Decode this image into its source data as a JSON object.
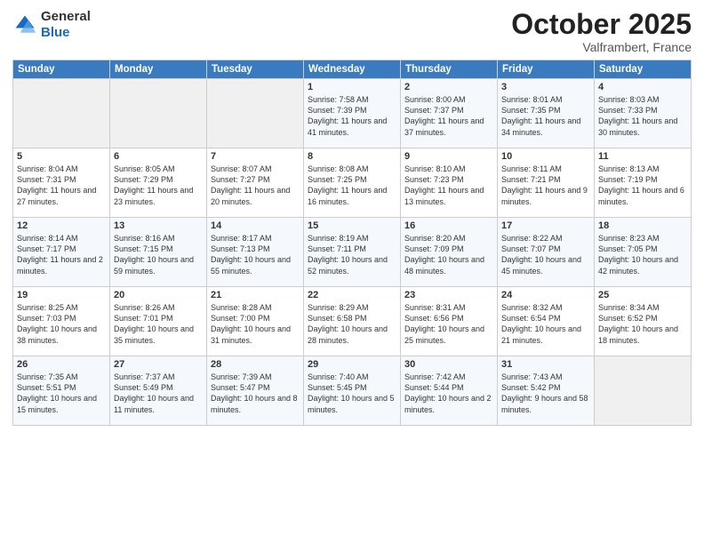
{
  "header": {
    "logo_general": "General",
    "logo_blue": "Blue",
    "month": "October 2025",
    "location": "Valframbert, France"
  },
  "weekdays": [
    "Sunday",
    "Monday",
    "Tuesday",
    "Wednesday",
    "Thursday",
    "Friday",
    "Saturday"
  ],
  "weeks": [
    [
      {
        "day": "",
        "sunrise": "",
        "sunset": "",
        "daylight": "",
        "empty": true
      },
      {
        "day": "",
        "sunrise": "",
        "sunset": "",
        "daylight": "",
        "empty": true
      },
      {
        "day": "",
        "sunrise": "",
        "sunset": "",
        "daylight": "",
        "empty": true
      },
      {
        "day": "1",
        "sunrise": "Sunrise: 7:58 AM",
        "sunset": "Sunset: 7:39 PM",
        "daylight": "Daylight: 11 hours and 41 minutes."
      },
      {
        "day": "2",
        "sunrise": "Sunrise: 8:00 AM",
        "sunset": "Sunset: 7:37 PM",
        "daylight": "Daylight: 11 hours and 37 minutes."
      },
      {
        "day": "3",
        "sunrise": "Sunrise: 8:01 AM",
        "sunset": "Sunset: 7:35 PM",
        "daylight": "Daylight: 11 hours and 34 minutes."
      },
      {
        "day": "4",
        "sunrise": "Sunrise: 8:03 AM",
        "sunset": "Sunset: 7:33 PM",
        "daylight": "Daylight: 11 hours and 30 minutes."
      }
    ],
    [
      {
        "day": "5",
        "sunrise": "Sunrise: 8:04 AM",
        "sunset": "Sunset: 7:31 PM",
        "daylight": "Daylight: 11 hours and 27 minutes."
      },
      {
        "day": "6",
        "sunrise": "Sunrise: 8:05 AM",
        "sunset": "Sunset: 7:29 PM",
        "daylight": "Daylight: 11 hours and 23 minutes."
      },
      {
        "day": "7",
        "sunrise": "Sunrise: 8:07 AM",
        "sunset": "Sunset: 7:27 PM",
        "daylight": "Daylight: 11 hours and 20 minutes."
      },
      {
        "day": "8",
        "sunrise": "Sunrise: 8:08 AM",
        "sunset": "Sunset: 7:25 PM",
        "daylight": "Daylight: 11 hours and 16 minutes."
      },
      {
        "day": "9",
        "sunrise": "Sunrise: 8:10 AM",
        "sunset": "Sunset: 7:23 PM",
        "daylight": "Daylight: 11 hours and 13 minutes."
      },
      {
        "day": "10",
        "sunrise": "Sunrise: 8:11 AM",
        "sunset": "Sunset: 7:21 PM",
        "daylight": "Daylight: 11 hours and 9 minutes."
      },
      {
        "day": "11",
        "sunrise": "Sunrise: 8:13 AM",
        "sunset": "Sunset: 7:19 PM",
        "daylight": "Daylight: 11 hours and 6 minutes."
      }
    ],
    [
      {
        "day": "12",
        "sunrise": "Sunrise: 8:14 AM",
        "sunset": "Sunset: 7:17 PM",
        "daylight": "Daylight: 11 hours and 2 minutes."
      },
      {
        "day": "13",
        "sunrise": "Sunrise: 8:16 AM",
        "sunset": "Sunset: 7:15 PM",
        "daylight": "Daylight: 10 hours and 59 minutes."
      },
      {
        "day": "14",
        "sunrise": "Sunrise: 8:17 AM",
        "sunset": "Sunset: 7:13 PM",
        "daylight": "Daylight: 10 hours and 55 minutes."
      },
      {
        "day": "15",
        "sunrise": "Sunrise: 8:19 AM",
        "sunset": "Sunset: 7:11 PM",
        "daylight": "Daylight: 10 hours and 52 minutes."
      },
      {
        "day": "16",
        "sunrise": "Sunrise: 8:20 AM",
        "sunset": "Sunset: 7:09 PM",
        "daylight": "Daylight: 10 hours and 48 minutes."
      },
      {
        "day": "17",
        "sunrise": "Sunrise: 8:22 AM",
        "sunset": "Sunset: 7:07 PM",
        "daylight": "Daylight: 10 hours and 45 minutes."
      },
      {
        "day": "18",
        "sunrise": "Sunrise: 8:23 AM",
        "sunset": "Sunset: 7:05 PM",
        "daylight": "Daylight: 10 hours and 42 minutes."
      }
    ],
    [
      {
        "day": "19",
        "sunrise": "Sunrise: 8:25 AM",
        "sunset": "Sunset: 7:03 PM",
        "daylight": "Daylight: 10 hours and 38 minutes."
      },
      {
        "day": "20",
        "sunrise": "Sunrise: 8:26 AM",
        "sunset": "Sunset: 7:01 PM",
        "daylight": "Daylight: 10 hours and 35 minutes."
      },
      {
        "day": "21",
        "sunrise": "Sunrise: 8:28 AM",
        "sunset": "Sunset: 7:00 PM",
        "daylight": "Daylight: 10 hours and 31 minutes."
      },
      {
        "day": "22",
        "sunrise": "Sunrise: 8:29 AM",
        "sunset": "Sunset: 6:58 PM",
        "daylight": "Daylight: 10 hours and 28 minutes."
      },
      {
        "day": "23",
        "sunrise": "Sunrise: 8:31 AM",
        "sunset": "Sunset: 6:56 PM",
        "daylight": "Daylight: 10 hours and 25 minutes."
      },
      {
        "day": "24",
        "sunrise": "Sunrise: 8:32 AM",
        "sunset": "Sunset: 6:54 PM",
        "daylight": "Daylight: 10 hours and 21 minutes."
      },
      {
        "day": "25",
        "sunrise": "Sunrise: 8:34 AM",
        "sunset": "Sunset: 6:52 PM",
        "daylight": "Daylight: 10 hours and 18 minutes."
      }
    ],
    [
      {
        "day": "26",
        "sunrise": "Sunrise: 7:35 AM",
        "sunset": "Sunset: 5:51 PM",
        "daylight": "Daylight: 10 hours and 15 minutes."
      },
      {
        "day": "27",
        "sunrise": "Sunrise: 7:37 AM",
        "sunset": "Sunset: 5:49 PM",
        "daylight": "Daylight: 10 hours and 11 minutes."
      },
      {
        "day": "28",
        "sunrise": "Sunrise: 7:39 AM",
        "sunset": "Sunset: 5:47 PM",
        "daylight": "Daylight: 10 hours and 8 minutes."
      },
      {
        "day": "29",
        "sunrise": "Sunrise: 7:40 AM",
        "sunset": "Sunset: 5:45 PM",
        "daylight": "Daylight: 10 hours and 5 minutes."
      },
      {
        "day": "30",
        "sunrise": "Sunrise: 7:42 AM",
        "sunset": "Sunset: 5:44 PM",
        "daylight": "Daylight: 10 hours and 2 minutes."
      },
      {
        "day": "31",
        "sunrise": "Sunrise: 7:43 AM",
        "sunset": "Sunset: 5:42 PM",
        "daylight": "Daylight: 9 hours and 58 minutes."
      },
      {
        "day": "",
        "sunrise": "",
        "sunset": "",
        "daylight": "",
        "empty": true
      }
    ]
  ]
}
